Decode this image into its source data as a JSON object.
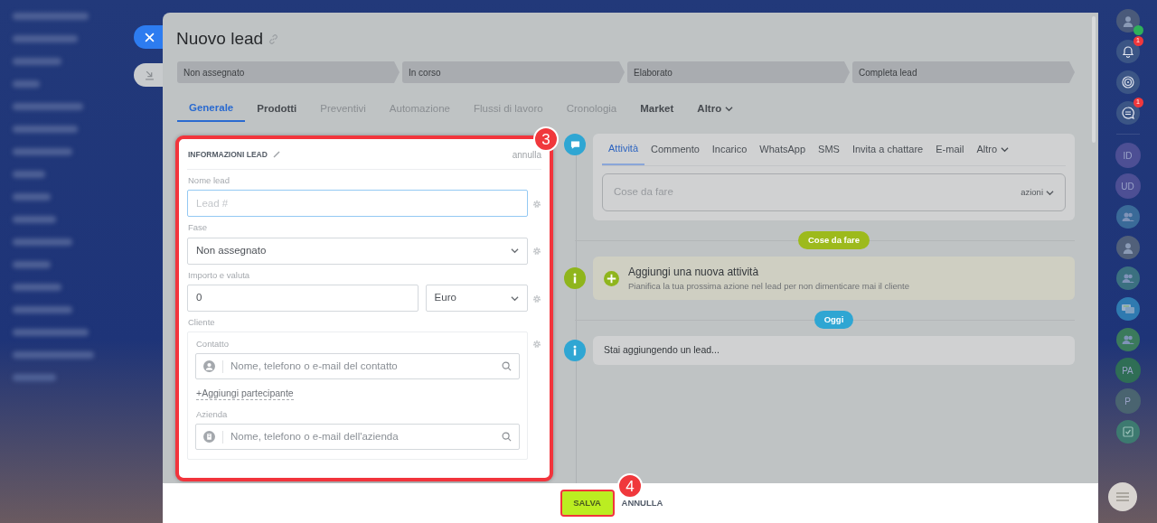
{
  "title": "Nuovo lead",
  "stages": [
    {
      "label": "Non assegnato"
    },
    {
      "label": "In corso"
    },
    {
      "label": "Elaborato"
    },
    {
      "label": "Completa lead"
    }
  ],
  "tabs": [
    {
      "label": "Generale",
      "selected": true,
      "disabled": false,
      "dropdown": false
    },
    {
      "label": "Prodotti",
      "selected": false,
      "disabled": false,
      "dropdown": false
    },
    {
      "label": "Preventivi",
      "selected": false,
      "disabled": true,
      "dropdown": false
    },
    {
      "label": "Automazione",
      "selected": false,
      "disabled": true,
      "dropdown": false
    },
    {
      "label": "Flussi di lavoro",
      "selected": false,
      "disabled": true,
      "dropdown": false
    },
    {
      "label": "Cronologia",
      "selected": false,
      "disabled": true,
      "dropdown": false
    },
    {
      "label": "Market",
      "selected": false,
      "disabled": false,
      "dropdown": false
    },
    {
      "label": "Altro",
      "selected": false,
      "disabled": false,
      "dropdown": true
    }
  ],
  "form": {
    "title": "INFORMAZIONI LEAD",
    "cancel": "annulla",
    "name_label": "Nome lead",
    "name_placeholder": "Lead #",
    "stage_label": "Fase",
    "stage_value": "Non assegnato",
    "amount_label": "Importo e valuta",
    "amount_value": "0",
    "currency_value": "Euro",
    "client_label": "Cliente",
    "contact_label": "Contatto",
    "contact_placeholder": "Nome, telefono o e-mail del contatto",
    "add_participant": "+Aggiungi partecipante",
    "company_label": "Azienda",
    "company_placeholder": "Nome, telefono o e-mail dell'azienda"
  },
  "timeline": {
    "tabs": [
      {
        "label": "Attività",
        "selected": true,
        "dropdown": false
      },
      {
        "label": "Commento",
        "selected": false,
        "dropdown": false
      },
      {
        "label": "Incarico",
        "selected": false,
        "dropdown": false
      },
      {
        "label": "WhatsApp",
        "selected": false,
        "dropdown": false
      },
      {
        "label": "SMS",
        "selected": false,
        "dropdown": false
      },
      {
        "label": "Invita a chattare",
        "selected": false,
        "dropdown": false
      },
      {
        "label": "E-mail",
        "selected": false,
        "dropdown": false
      },
      {
        "label": "Altro",
        "selected": false,
        "dropdown": true
      }
    ],
    "composer_placeholder": "Cose da fare",
    "composer_actions": "azioni",
    "entries": [
      {
        "kind": "divider",
        "text": "Cose da fare",
        "color": "#9dba1c"
      },
      {
        "kind": "todo",
        "title": "Aggiungi una nuova attività",
        "subtitle": "Pianifica la tua prossima azione nel lead per non dimenticare mai il cliente"
      },
      {
        "kind": "divider",
        "text": "Oggi",
        "color": "#2fa6d3"
      },
      {
        "kind": "info",
        "title": "Stai aggiungendo un lead..."
      }
    ]
  },
  "footer": {
    "save": "SALVA",
    "cancel": "ANNULLA"
  },
  "callouts": [
    {
      "number": "3"
    },
    {
      "number": "4"
    }
  ],
  "rail": [
    {
      "kind": "avatar",
      "color": "#4a5a7a"
    },
    {
      "kind": "bell",
      "badge": "1",
      "color": "#3b5585"
    },
    {
      "kind": "spiral",
      "color": "#3b5585"
    },
    {
      "kind": "chat",
      "badge": "1",
      "color": "#3b5585"
    },
    {
      "kind": "initials",
      "text": "ID",
      "color": "#4d4f94"
    },
    {
      "kind": "initials",
      "text": "UD",
      "color": "#4d4f94"
    },
    {
      "kind": "group",
      "color": "#3a6a98"
    },
    {
      "kind": "avatar",
      "color": "#51607a"
    },
    {
      "kind": "group",
      "color": "#3b7080"
    },
    {
      "kind": "messages",
      "color": "#2f7ab0"
    },
    {
      "kind": "group",
      "color": "#3b7a5c"
    },
    {
      "kind": "initials",
      "text": "PA",
      "color": "#2f6e55"
    },
    {
      "kind": "initials",
      "text": "P",
      "color": "#4a6470"
    },
    {
      "kind": "check",
      "color": "#3d7a70"
    }
  ]
}
